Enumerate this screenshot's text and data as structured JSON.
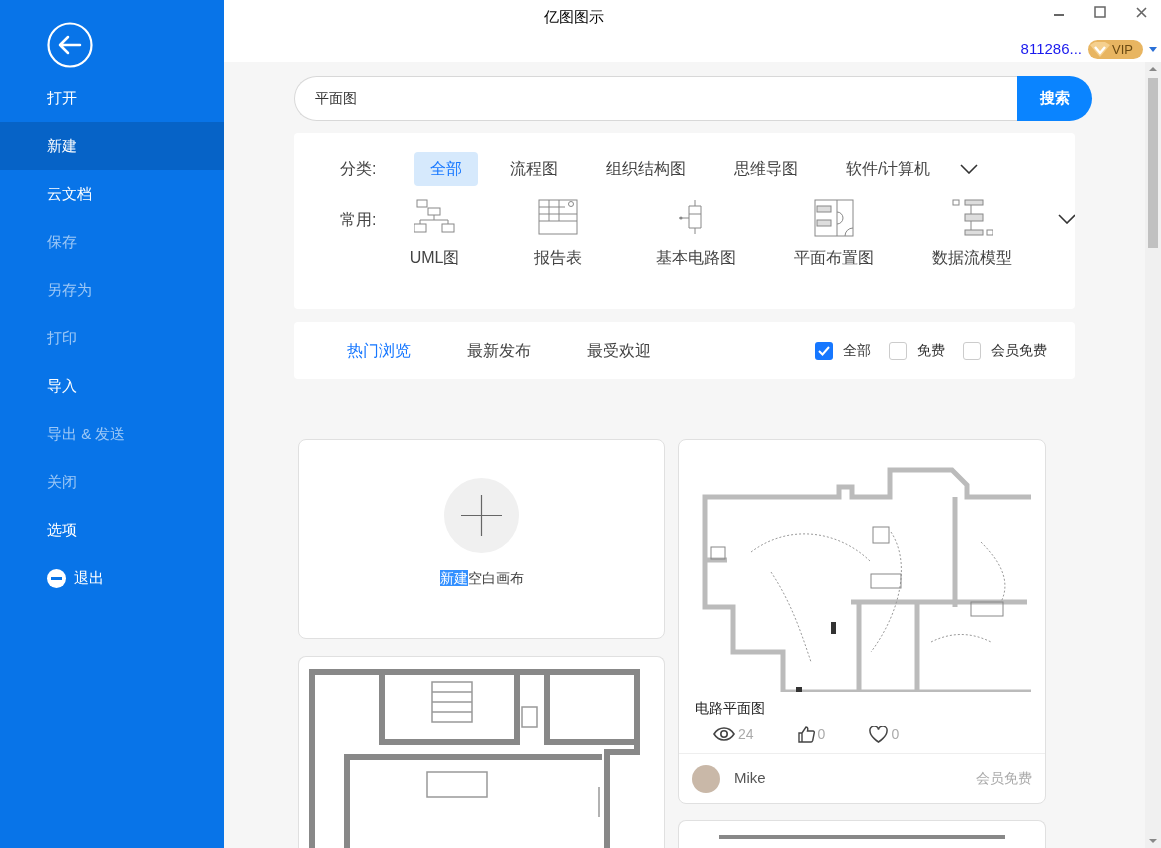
{
  "window": {
    "title": "亿图图示",
    "account": "811286...",
    "vip_badge": "VIP"
  },
  "sidebar": {
    "items": [
      {
        "label": "打开",
        "kind": "item",
        "selected": false,
        "disabled": false
      },
      {
        "label": "新建",
        "kind": "item",
        "selected": true,
        "disabled": false
      },
      {
        "label": "云文档",
        "kind": "item",
        "selected": false,
        "disabled": false
      },
      {
        "label": "保存",
        "kind": "item",
        "selected": false,
        "disabled": true
      },
      {
        "label": "另存为",
        "kind": "item",
        "selected": false,
        "disabled": true
      },
      {
        "label": "打印",
        "kind": "item",
        "selected": false,
        "disabled": true
      },
      {
        "label": "导入",
        "kind": "item",
        "selected": false,
        "disabled": false
      },
      {
        "label": "导出 & 发送",
        "kind": "item",
        "selected": false,
        "disabled": true
      },
      {
        "label": "关闭",
        "kind": "item",
        "selected": false,
        "disabled": true
      },
      {
        "label": "选项",
        "kind": "item",
        "selected": false,
        "disabled": false
      },
      {
        "label": "退出",
        "kind": "exit",
        "selected": false,
        "disabled": false
      }
    ]
  },
  "search": {
    "value": "平面图",
    "button": "搜索"
  },
  "categories": {
    "label": "分类:",
    "items": [
      {
        "label": "全部",
        "selected": true
      },
      {
        "label": "流程图",
        "selected": false
      },
      {
        "label": "组织结构图",
        "selected": false
      },
      {
        "label": "思维导图",
        "selected": false
      },
      {
        "label": "软件/计算机",
        "selected": false
      }
    ]
  },
  "common": {
    "label": "常用:",
    "items": [
      {
        "label": "UML图",
        "kind": "uml"
      },
      {
        "label": "报告表",
        "kind": "report"
      },
      {
        "label": "基本电路图",
        "kind": "circuit"
      },
      {
        "label": "平面布置图",
        "kind": "floor"
      },
      {
        "label": "数据流模型",
        "kind": "dataflow"
      }
    ]
  },
  "sort_tabs": [
    {
      "label": "热门浏览",
      "selected": true
    },
    {
      "label": "最新发布",
      "selected": false
    },
    {
      "label": "最受欢迎",
      "selected": false
    }
  ],
  "filters": [
    {
      "label": "全部",
      "checked": true
    },
    {
      "label": "免费",
      "checked": false
    },
    {
      "label": "会员免费",
      "checked": false
    }
  ],
  "new_blank": {
    "label_selected": "新建",
    "label_rest": "空白画布"
  },
  "templates": [
    {
      "title": "电路平面图",
      "views": "24",
      "likes": "0",
      "favorites": "0",
      "author": "Mike",
      "price": "会员免费"
    }
  ]
}
